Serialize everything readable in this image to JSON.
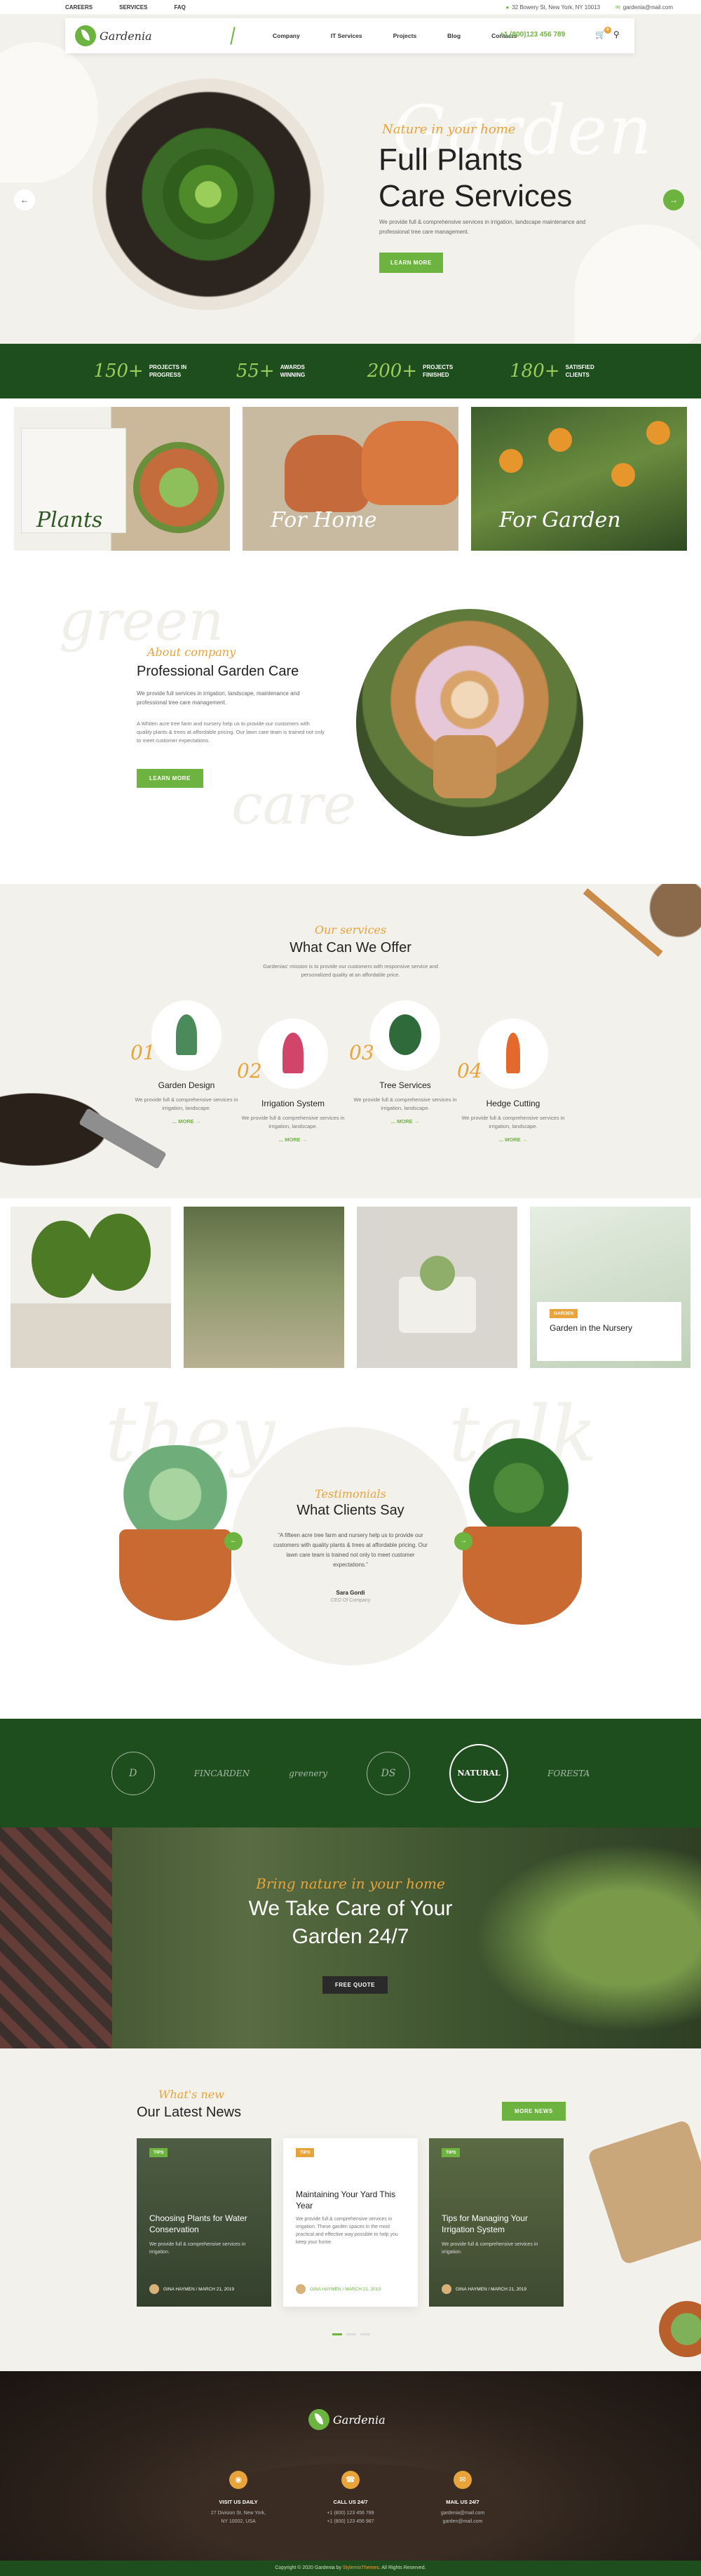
{
  "topbar": {
    "links": [
      "CAREERS",
      "SERVICES",
      "FAQ"
    ],
    "address": "32 Bowery St, New York, NY 10013",
    "email": "gardenia@mail.com"
  },
  "nav": {
    "logo": "Gardenia",
    "menu": [
      "Company",
      "IT Services",
      "Projects",
      "Blog",
      "Contacts"
    ],
    "phone": "+1 (800)123 456 789",
    "cart_count": "0"
  },
  "hero": {
    "ghost": "Garden",
    "tagline": "Nature in your home",
    "title_line1": "Full Plants",
    "title_line2": "Care Services",
    "description": "We provide full & comprehensive services in irrigation, landscape maintenance and professional tree care management.",
    "button": "LEARN MORE"
  },
  "stats": [
    {
      "number": "150+",
      "label": "PROJECTS IN PROGRESS"
    },
    {
      "number": "55+",
      "label": "AWARDS WINNING"
    },
    {
      "number": "200+",
      "label": "PROJECTS FINISHED"
    },
    {
      "number": "180+",
      "label": "SATISFIED CLIENTS"
    }
  ],
  "categories": [
    "Plants",
    "For Home",
    "For Garden"
  ],
  "about": {
    "ghost1": "green",
    "ghost2": "care",
    "tagline": "About company",
    "title": "Professional Garden Care",
    "p1": "We provide full services in irrigation, landscape, maintenance and professional tree care management.",
    "p2": "A Whiten acre tree farm and nursery help us to provide our customers with quality plants & trees at affordable pricing. Our lawn care team is trained not only to meet customer expectations.",
    "button": "LEARN MORE"
  },
  "services": {
    "tagline": "Our services",
    "title": "What Can We Offer",
    "intro": "Gardenias' mission is to provide our customers with responsive service and personalized quality at an affordable price.",
    "items": [
      {
        "num": "01",
        "title": "Garden Design",
        "text": "We provide full & comprehensive services in irrigation, landscape.",
        "more": "MORE"
      },
      {
        "num": "02",
        "title": "Irrigation System",
        "text": "We provide full & comprehensive services in irrigation, landscape.",
        "more": "MORE"
      },
      {
        "num": "03",
        "title": "Tree Services",
        "text": "We provide full & comprehensive services in irrigation, landscape.",
        "more": "MORE"
      },
      {
        "num": "04",
        "title": "Hedge Cutting",
        "text": "We provide full & comprehensive services in irrigation, landscape.",
        "more": "MORE"
      }
    ]
  },
  "gallery": {
    "badge": "GARDEN",
    "title": "Garden in the Nursery"
  },
  "testimonials": {
    "ghost1": "they",
    "ghost2": "talk",
    "tagline": "Testimonials",
    "title": "What Clients Say",
    "quote": "“A fifteen acre tree farm and nursery help us to provide our customers with quality plants & trees at affordable pricing. Our lawn care team is trained not only to meet customer expectations.”",
    "name": "Sara Gordi",
    "role": "CEO Of Company"
  },
  "partners": [
    "D",
    "FINCARDEN",
    "greenery",
    "DS",
    "NATURAL",
    "FORESTA"
  ],
  "cta": {
    "tagline": "Bring nature in your home",
    "title_line1": "We Take Care of Your",
    "title_line2": "Garden 24/7",
    "button": "FREE QUOTE"
  },
  "news": {
    "tagline": "What's new",
    "title": "Our Latest News",
    "button": "MORE NEWS",
    "posts": [
      {
        "badge": "TIPS",
        "title": "Choosing Plants for Water Conservation",
        "text": "We provide full & comprehensive services in irrigation.",
        "meta": "GINA HAYMEN / MARCH 21, 2019"
      },
      {
        "badge": "TIPS",
        "title": "Maintaining Your Yard This Year",
        "text": "We provide full & comprehensive services in irrigation. These garden spaces in the most practical and effective way possible to help you keep your home.",
        "meta": "GINA HAYMEN / MARCH 21, 2019"
      },
      {
        "badge": "TIPS",
        "title": "Tips for Managing Your Irrigation System",
        "text": "We provide full & comprehensive services in irrigation.",
        "meta": "GINA HAYMEN / MARCH 21, 2019"
      }
    ]
  },
  "footer": {
    "logo": "Gardenia",
    "cols": [
      {
        "icon": "◉",
        "title": "VISIT US DAILY",
        "line1": "27 Division St. New York,",
        "line2": "NY 10002, USA"
      },
      {
        "icon": "☎",
        "title": "CALL US 24/7",
        "line1": "+1 (800) 123 456 789",
        "line2": "+1 (800) 123 456 987"
      },
      {
        "icon": "✉",
        "title": "MAIL US 24/7",
        "line1": "gardenia@mail.com",
        "line2": "garden@mail.com"
      }
    ],
    "copyright_prefix": "Copyright © 2020 Gardenia by",
    "copyright_brand": "StylemixThemes",
    "copyright_suffix": ". All Rights Reserved."
  }
}
